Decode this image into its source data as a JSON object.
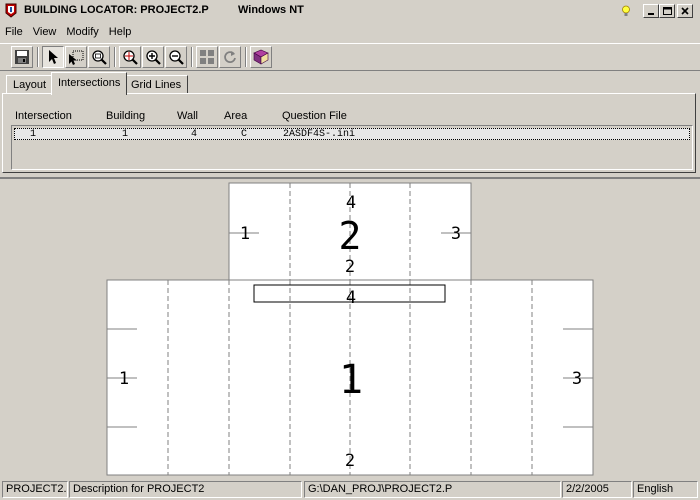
{
  "window": {
    "title": "BUILDING LOCATOR: PROJECT2.P",
    "os_label": "Windows NT",
    "controls": {
      "minimize": "_",
      "maximize": "□",
      "close": "×"
    }
  },
  "menu": [
    {
      "label": "File"
    },
    {
      "label": "View"
    },
    {
      "label": "Modify"
    },
    {
      "label": "Help"
    }
  ],
  "toolbar": {
    "icons": [
      "save-icon",
      "pointer-icon",
      "select-building-icon",
      "zoom-area-icon",
      "zoom-fit-icon",
      "zoom-in-icon",
      "zoom-out-icon",
      "grid-icon",
      "refresh-icon",
      "book-icon"
    ]
  },
  "tabs": [
    {
      "label": "Layout"
    },
    {
      "label": "Intersections"
    },
    {
      "label": "Grid Lines"
    }
  ],
  "intersections": {
    "columns": [
      "Intersection",
      "Building",
      "Wall",
      "Area",
      "Question File"
    ],
    "rows": [
      {
        "intersection": "1",
        "building": "1",
        "wall": "4",
        "area": "C",
        "question_file": "2ASDF4S-.ini"
      }
    ]
  },
  "plan": {
    "building2": {
      "number": "2",
      "walls": {
        "top": "4",
        "bottom": "2",
        "left": "1",
        "right": "3"
      }
    },
    "building1": {
      "number": "1",
      "walls": {
        "top": "4",
        "bottom": "2",
        "left": "1",
        "right": "3"
      }
    }
  },
  "status": {
    "project": "PROJECT2.P",
    "description": "Description for PROJECT2",
    "path": "G:\\DAN_PROJ\\PROJECT2.P",
    "date": "2/2/2005",
    "language": "English"
  }
}
